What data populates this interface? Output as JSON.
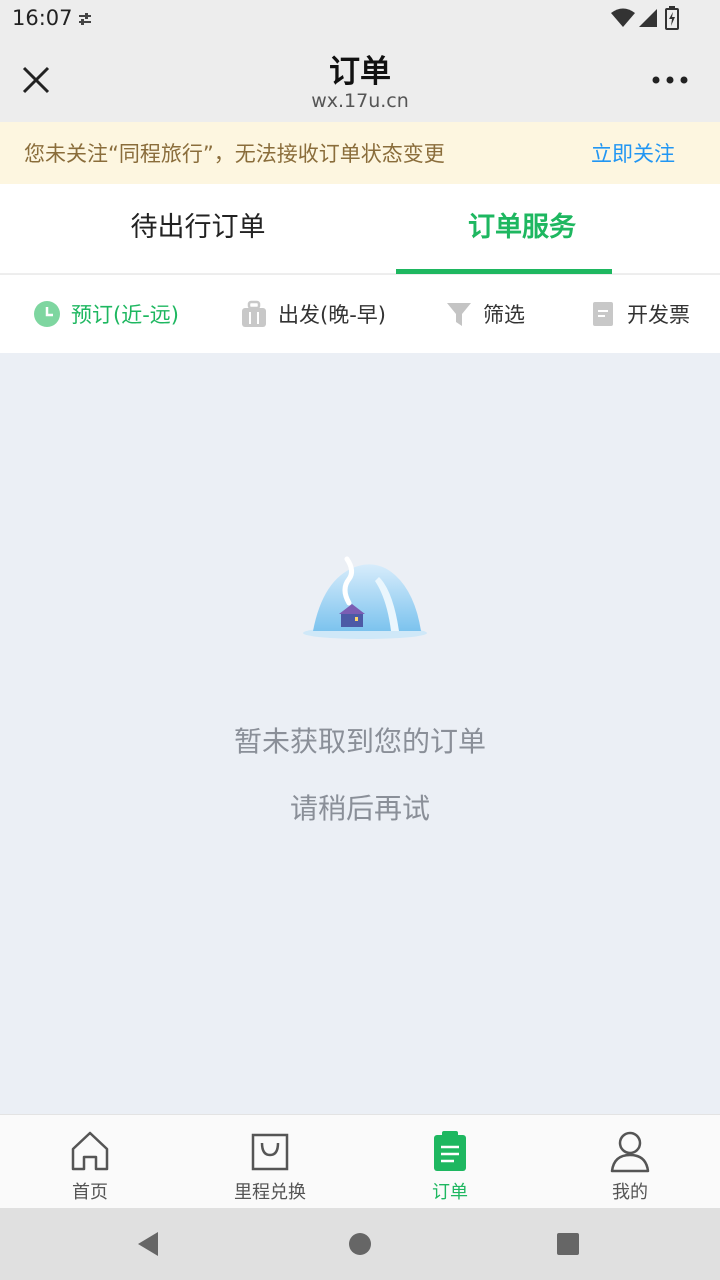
{
  "status": {
    "time": "16:07"
  },
  "header": {
    "title": "订单",
    "subtitle": "wx.17u.cn"
  },
  "notice": {
    "text": "您未关注“同程旅行”，无法接收订单状态变更",
    "action": "立即关注"
  },
  "tabs": [
    {
      "label": "待出行订单",
      "active": false
    },
    {
      "label": "订单服务",
      "active": true
    }
  ],
  "filters": [
    {
      "label": "预订(近-远)",
      "icon": "clock-icon",
      "active": true
    },
    {
      "label": "出发(晚-早)",
      "icon": "luggage-icon",
      "active": false
    },
    {
      "label": "筛选",
      "icon": "funnel-icon",
      "active": false
    },
    {
      "label": "开发票",
      "icon": "invoice-icon",
      "active": false
    }
  ],
  "empty": {
    "line1": "暂未获取到您的订单",
    "line2": "请稍后再试"
  },
  "tabbar": [
    {
      "label": "首页",
      "icon": "home-icon",
      "active": false
    },
    {
      "label": "里程兑换",
      "icon": "shopping-bag-icon",
      "active": false
    },
    {
      "label": "订单",
      "icon": "order-clipboard-icon",
      "active": true
    },
    {
      "label": "我的",
      "icon": "user-icon",
      "active": false
    }
  ],
  "colors": {
    "accent": "#1eb760",
    "link": "#2196f3",
    "notice_bg": "#fdf6e0",
    "notice_text": "#8a6d3b"
  }
}
